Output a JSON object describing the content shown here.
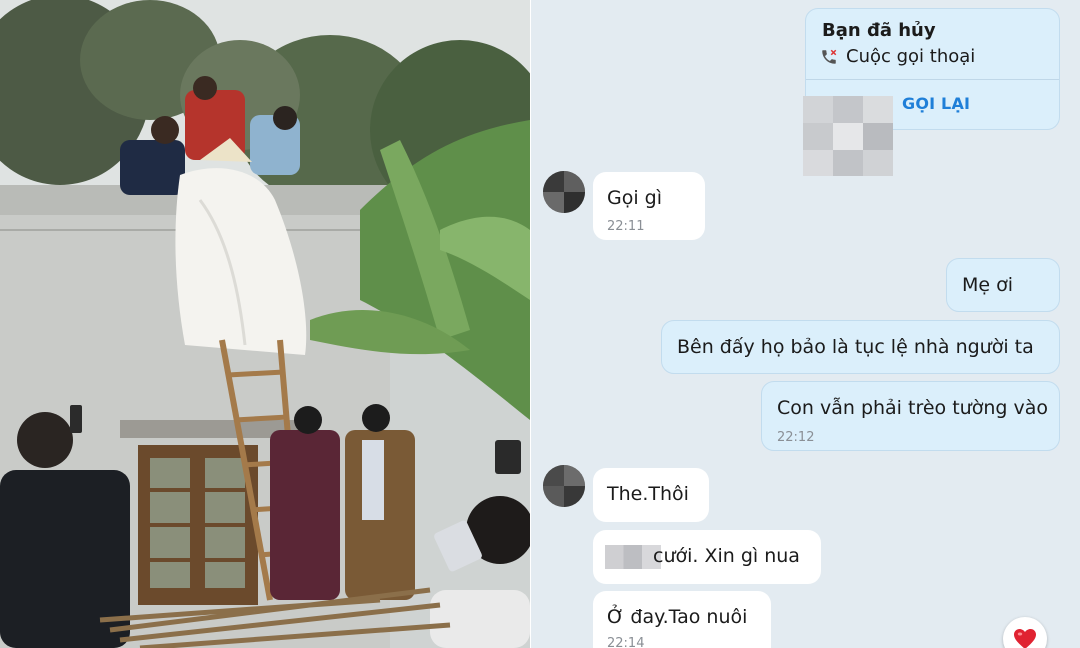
{
  "photo": {
    "alt": "",
    "ladder_color": "#a47a4a",
    "wall_color": "#c9cbc8"
  },
  "chat": {
    "background": "#e3ebf1",
    "call_card": {
      "title": "Bạn đã hủy",
      "subtitle": "Cuộc gọi thoại",
      "action": "GỌI LẠI",
      "icon": "phone-icon"
    },
    "messages": [
      {
        "side": "in",
        "text": "Gọi gì",
        "time": "22:11"
      },
      {
        "side": "out",
        "text": "Mẹ ơi",
        "time": ""
      },
      {
        "side": "out",
        "text": "Bên đấy họ bảo là tục lệ nhà người ta",
        "time": ""
      },
      {
        "side": "out",
        "text": "Con vẫn phải trèo tường vào",
        "time": "22:12"
      },
      {
        "side": "in",
        "text": "The.Thôi",
        "time": ""
      },
      {
        "side": "in",
        "text": "cưới. Xin gì nua",
        "time": ""
      },
      {
        "side": "in",
        "text": "Ở đay.Tao nuôi",
        "time": "22:14"
      }
    ],
    "reaction": "heart-icon"
  }
}
